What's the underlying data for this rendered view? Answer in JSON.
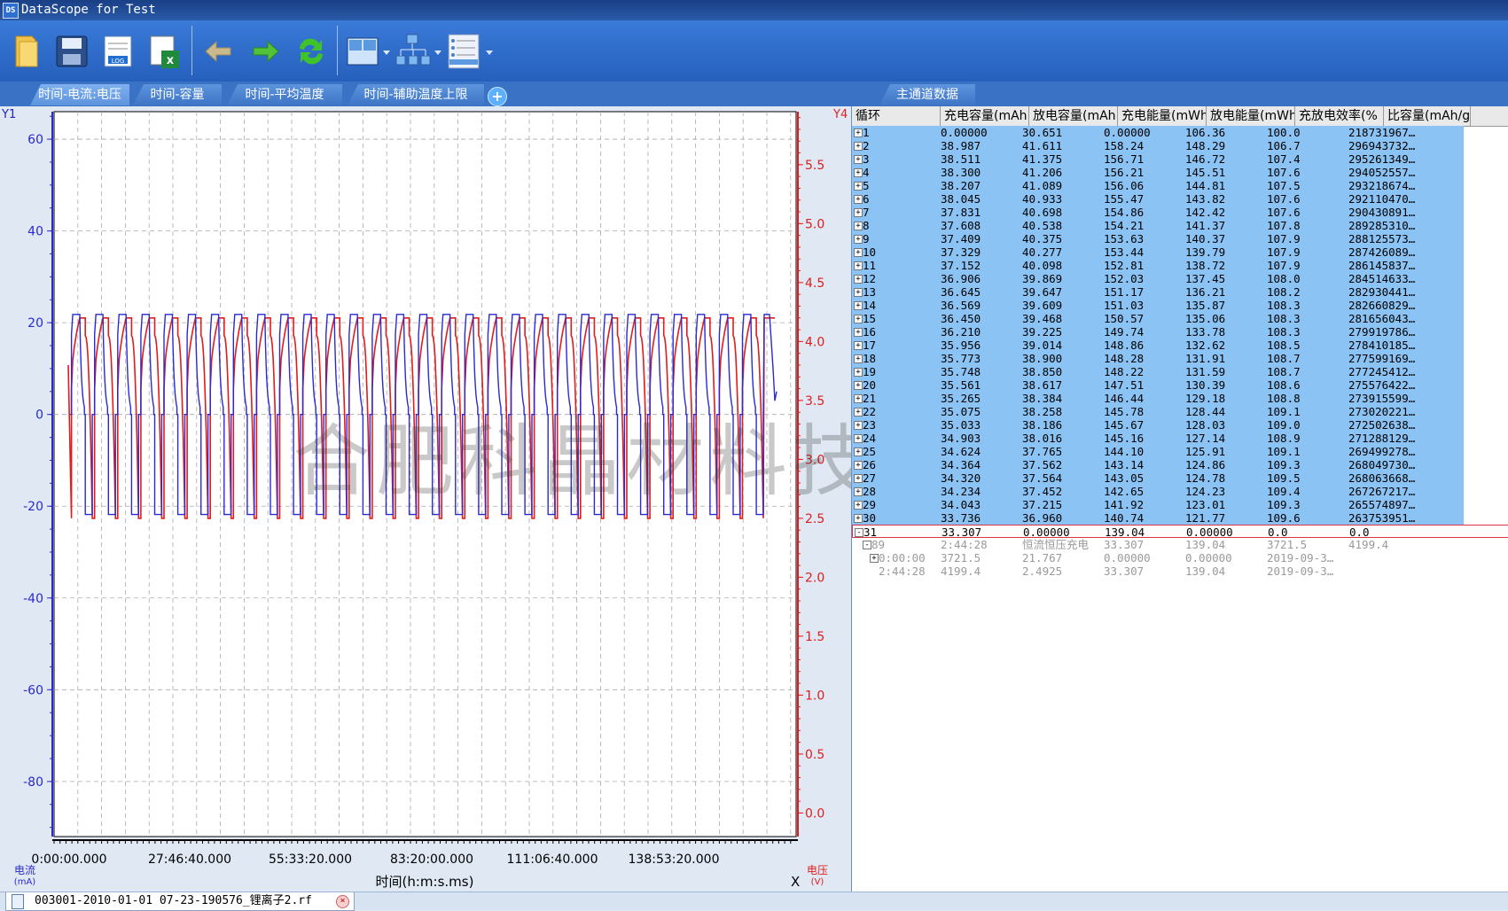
{
  "window": {
    "title": "DataScope for Test",
    "icon_text": "DS"
  },
  "toolbar": {
    "buttons": [
      {
        "name": "open-folder-icon"
      },
      {
        "name": "save-disk-icon"
      },
      {
        "name": "log-icon",
        "text": "LOG"
      },
      {
        "name": "export-excel-icon"
      },
      {
        "name": "back-arrow-icon"
      },
      {
        "name": "forward-arrow-icon"
      },
      {
        "name": "refresh-icon"
      },
      {
        "name": "layout-icon"
      },
      {
        "name": "tree-structure-icon"
      },
      {
        "name": "list-view-icon"
      }
    ]
  },
  "chart_tabs": [
    "时间-电流:电压",
    "时间-容量",
    "时间-平均温度",
    "时间-辅助温度上限"
  ],
  "data_tab": "主通道数据",
  "chart": {
    "y1_label": "Y1",
    "y4_label": "Y4",
    "left_axis_unit_line1": "电流",
    "left_axis_unit_line2": "(mA)",
    "right_axis_unit_line1": "电压",
    "right_axis_unit_line2": "(V)",
    "x_title": "时间(h:m:s.ms)",
    "x_marker": "X",
    "colors": {
      "current": "#2a2ad0",
      "voltage": "#e01c1c",
      "grid": "#aaaaaa"
    }
  },
  "chart_data": {
    "type": "line",
    "xlabel": "时间(h:m:s.ms)",
    "x_ticks": [
      "0:00:00.000",
      "27:46:40.000",
      "55:33:20.000",
      "83:20:00.000",
      "111:06:40.000",
      "138:53:20.000"
    ],
    "y1": {
      "label": "电流 (mA)",
      "ticks": [
        60,
        40,
        20,
        0,
        -20,
        -40,
        -60,
        -80
      ],
      "range": [
        -92,
        66
      ]
    },
    "y4": {
      "label": "电压 (V)",
      "ticks": [
        5.5,
        5.0,
        4.5,
        4.0,
        3.5,
        3.0,
        2.5,
        2.0,
        1.5,
        1.0,
        0.5,
        0.0
      ],
      "range": [
        -0.2,
        5.95
      ]
    },
    "cycles": 30,
    "series": [
      {
        "name": "电流",
        "axis": "y1",
        "charge_current_mA": 21.8,
        "discharge_current_mA": -21.8
      },
      {
        "name": "电压",
        "axis": "y4",
        "upper_V": 4.2,
        "lower_V": 2.5
      }
    ]
  },
  "grid": {
    "headers": [
      "循环",
      "充电容量(mAh",
      "放电容量(mAh",
      "充电能量(mWh",
      "放电能量(mWh",
      "充放电效率(%",
      "比容量(mAh/g"
    ],
    "rows": [
      {
        "id": "1",
        "c1": "0.00000",
        "c2": "30.651",
        "c3": "0.00000",
        "c4": "106.36",
        "c5": "100.0",
        "c6": "218731967…"
      },
      {
        "id": "2",
        "c1": "38.987",
        "c2": "41.611",
        "c3": "158.24",
        "c4": "148.29",
        "c5": "106.7",
        "c6": "296943732…"
      },
      {
        "id": "3",
        "c1": "38.511",
        "c2": "41.375",
        "c3": "156.71",
        "c4": "146.72",
        "c5": "107.4",
        "c6": "295261349…"
      },
      {
        "id": "4",
        "c1": "38.300",
        "c2": "41.206",
        "c3": "156.21",
        "c4": "145.51",
        "c5": "107.6",
        "c6": "294052557…"
      },
      {
        "id": "5",
        "c1": "38.207",
        "c2": "41.089",
        "c3": "156.06",
        "c4": "144.81",
        "c5": "107.5",
        "c6": "293218674…"
      },
      {
        "id": "6",
        "c1": "38.045",
        "c2": "40.933",
        "c3": "155.47",
        "c4": "143.82",
        "c5": "107.6",
        "c6": "292110470…"
      },
      {
        "id": "7",
        "c1": "37.831",
        "c2": "40.698",
        "c3": "154.86",
        "c4": "142.42",
        "c5": "107.6",
        "c6": "290430891…"
      },
      {
        "id": "8",
        "c1": "37.608",
        "c2": "40.538",
        "c3": "154.21",
        "c4": "141.37",
        "c5": "107.8",
        "c6": "289285310…"
      },
      {
        "id": "9",
        "c1": "37.409",
        "c2": "40.375",
        "c3": "153.63",
        "c4": "140.37",
        "c5": "107.9",
        "c6": "288125573…"
      },
      {
        "id": "10",
        "c1": "37.329",
        "c2": "40.277",
        "c3": "153.44",
        "c4": "139.79",
        "c5": "107.9",
        "c6": "287426089…"
      },
      {
        "id": "11",
        "c1": "37.152",
        "c2": "40.098",
        "c3": "152.81",
        "c4": "138.72",
        "c5": "107.9",
        "c6": "286145837…"
      },
      {
        "id": "12",
        "c1": "36.906",
        "c2": "39.869",
        "c3": "152.03",
        "c4": "137.45",
        "c5": "108.0",
        "c6": "284514633…"
      },
      {
        "id": "13",
        "c1": "36.645",
        "c2": "39.647",
        "c3": "151.17",
        "c4": "136.21",
        "c5": "108.2",
        "c6": "282930441…"
      },
      {
        "id": "14",
        "c1": "36.569",
        "c2": "39.609",
        "c3": "151.03",
        "c4": "135.87",
        "c5": "108.3",
        "c6": "282660829…"
      },
      {
        "id": "15",
        "c1": "36.450",
        "c2": "39.468",
        "c3": "150.57",
        "c4": "135.06",
        "c5": "108.3",
        "c6": "281656043…"
      },
      {
        "id": "16",
        "c1": "36.210",
        "c2": "39.225",
        "c3": "149.74",
        "c4": "133.78",
        "c5": "108.3",
        "c6": "279919786…"
      },
      {
        "id": "17",
        "c1": "35.956",
        "c2": "39.014",
        "c3": "148.86",
        "c4": "132.62",
        "c5": "108.5",
        "c6": "278410185…"
      },
      {
        "id": "18",
        "c1": "35.773",
        "c2": "38.900",
        "c3": "148.28",
        "c4": "131.91",
        "c5": "108.7",
        "c6": "277599169…"
      },
      {
        "id": "19",
        "c1": "35.748",
        "c2": "38.850",
        "c3": "148.22",
        "c4": "131.59",
        "c5": "108.7",
        "c6": "277245412…"
      },
      {
        "id": "20",
        "c1": "35.561",
        "c2": "38.617",
        "c3": "147.51",
        "c4": "130.39",
        "c5": "108.6",
        "c6": "275576422…"
      },
      {
        "id": "21",
        "c1": "35.265",
        "c2": "38.384",
        "c3": "146.44",
        "c4": "129.18",
        "c5": "108.8",
        "c6": "273915599…"
      },
      {
        "id": "22",
        "c1": "35.075",
        "c2": "38.258",
        "c3": "145.78",
        "c4": "128.44",
        "c5": "109.1",
        "c6": "273020221…"
      },
      {
        "id": "23",
        "c1": "35.033",
        "c2": "38.186",
        "c3": "145.67",
        "c4": "128.03",
        "c5": "109.0",
        "c6": "272502638…"
      },
      {
        "id": "24",
        "c1": "34.903",
        "c2": "38.016",
        "c3": "145.16",
        "c4": "127.14",
        "c5": "108.9",
        "c6": "271288129…"
      },
      {
        "id": "25",
        "c1": "34.624",
        "c2": "37.765",
        "c3": "144.10",
        "c4": "125.91",
        "c5": "109.1",
        "c6": "269499278…"
      },
      {
        "id": "26",
        "c1": "34.364",
        "c2": "37.562",
        "c3": "143.14",
        "c4": "124.86",
        "c5": "109.3",
        "c6": "268049730…"
      },
      {
        "id": "27",
        "c1": "34.320",
        "c2": "37.564",
        "c3": "143.05",
        "c4": "124.78",
        "c5": "109.5",
        "c6": "268063668…"
      },
      {
        "id": "28",
        "c1": "34.234",
        "c2": "37.452",
        "c3": "142.65",
        "c4": "124.23",
        "c5": "109.4",
        "c6": "267267217…"
      },
      {
        "id": "29",
        "c1": "34.043",
        "c2": "37.215",
        "c3": "141.92",
        "c4": "123.01",
        "c5": "109.3",
        "c6": "265574897…"
      },
      {
        "id": "30",
        "c1": "33.736",
        "c2": "36.960",
        "c3": "140.74",
        "c4": "121.77",
        "c5": "109.6",
        "c6": "263753951…"
      }
    ],
    "row31": {
      "id": "31",
      "c1": "33.307",
      "c2": "0.00000",
      "c3": "139.04",
      "c4": "0.00000",
      "c5": "0.0",
      "c6": "0.0"
    },
    "sub_rows": [
      {
        "id": "89",
        "c1": "2:44:28",
        "c2": "恒流恒压充电",
        "c3": "33.307",
        "c4": "139.04",
        "c5": "3721.5",
        "c6": "4199.4"
      },
      {
        "id": "0:00:00",
        "c1": "3721.5",
        "c2": "21.767",
        "c3": "0.00000",
        "c4": "0.00000",
        "c5": "2019-09-3…"
      },
      {
        "id": "2:44:28",
        "c1": "4199.4",
        "c2": "2.4925",
        "c3": "33.307",
        "c4": "139.04",
        "c5": "2019-09-3…"
      }
    ]
  },
  "watermark": "合肥科晶材料技术有限公司",
  "status": {
    "file": "003001-2010-01-01 07-23-190576_锂离子2.rf"
  }
}
